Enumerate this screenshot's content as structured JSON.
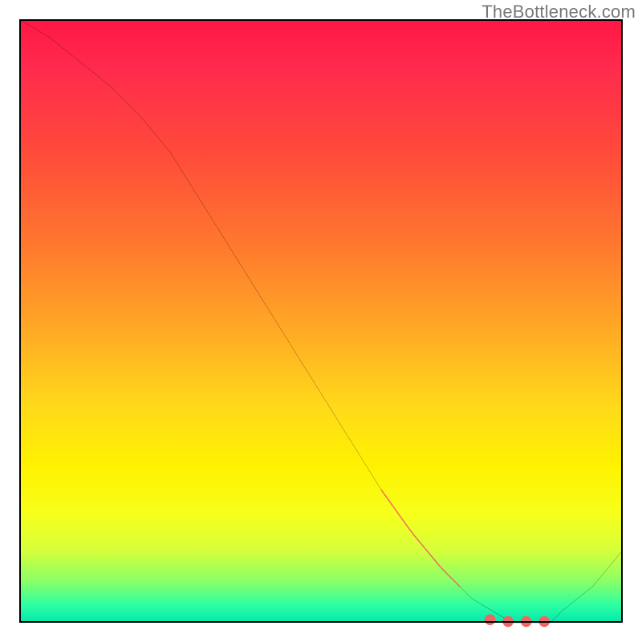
{
  "watermark": "TheBottleneck.com",
  "colors": {
    "curve_stroke": "#000000",
    "marker_fill": "#f06563",
    "frame": "#000000"
  },
  "chart_data": {
    "type": "line",
    "title": "",
    "xlabel": "",
    "ylabel": "",
    "xlim": [
      0,
      100
    ],
    "ylim": [
      0,
      100
    ],
    "x": [
      0,
      5,
      10,
      15,
      20,
      25,
      30,
      35,
      40,
      45,
      50,
      55,
      60,
      65,
      70,
      75,
      80,
      82,
      85,
      88,
      90,
      95,
      100
    ],
    "values": [
      100,
      97,
      93,
      89,
      84,
      78,
      70,
      62,
      54,
      46,
      38,
      30,
      22,
      15,
      9,
      4,
      1,
      0,
      0,
      0,
      2,
      6,
      12
    ],
    "markers": {
      "segment_a": {
        "x_start": 60,
        "x_end": 73,
        "note": "coral segment on descending limb"
      },
      "points_b": [
        {
          "x": 78,
          "y": 0.5
        },
        {
          "x": 81,
          "y": 0.2
        },
        {
          "x": 84,
          "y": 0.2
        },
        {
          "x": 87,
          "y": 0.2
        }
      ]
    }
  }
}
